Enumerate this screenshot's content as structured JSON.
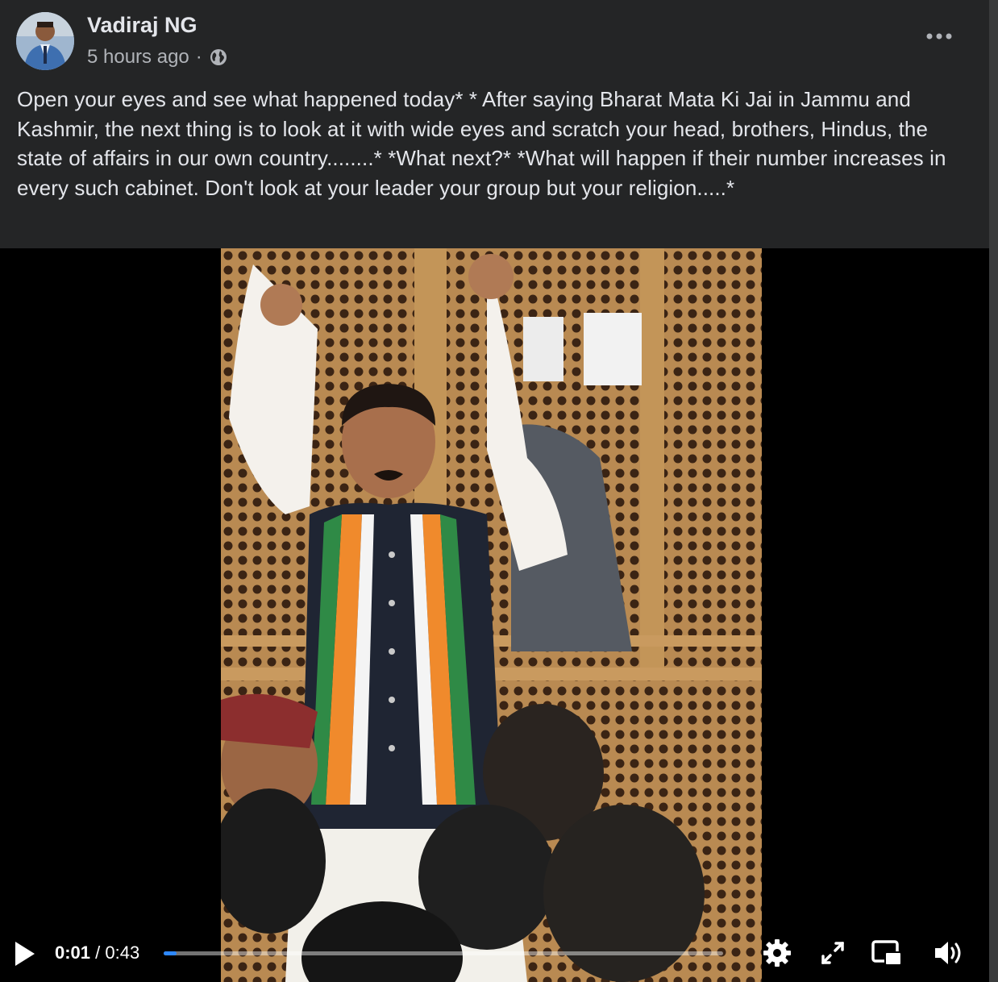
{
  "post": {
    "author": "Vadiraj NG",
    "time_ago": "5 hours ago",
    "separator": "·",
    "privacy_icon": "globe-icon",
    "more_icon": "more-options-icon",
    "text": "Open your eyes and see what happened today* * After saying Bharat Mata Ki Jai in Jammu and Kashmir, the next thing is to look at it with wide eyes and scratch your head, brothers, Hindus, the state of affairs in our own country........* *What next?* *What will happen if their number increases in every such cabinet. Don't look at your leader your group but your religion.....*"
  },
  "video": {
    "current_time": "0:01",
    "time_separator": " / ",
    "duration": "0:43",
    "progress": 0.023,
    "progress_color": "#2d88ff",
    "controls": [
      "play-icon",
      "settings-icon",
      "fullscreen-icon",
      "picture-in-picture-icon",
      "volume-icon"
    ]
  }
}
